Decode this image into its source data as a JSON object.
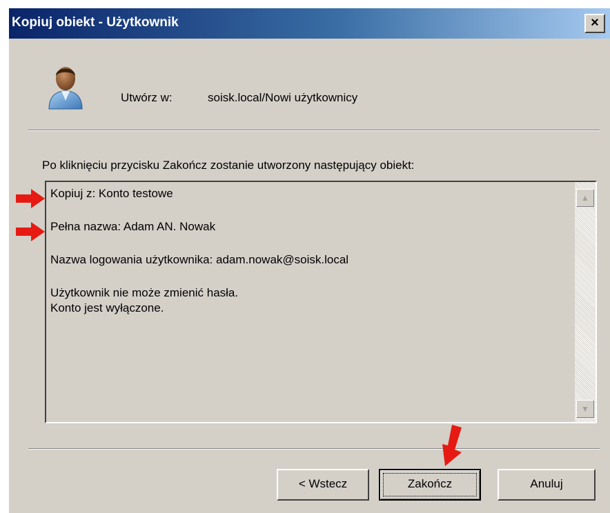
{
  "window": {
    "title": "Kopiuj obiekt - Użytkownik",
    "close_glyph": "×"
  },
  "header": {
    "icon": "user-icon",
    "create_label": "Utwórz w:",
    "create_path": "soisk.local/Nowi użytkownicy"
  },
  "intro": "Po kliknięciu przycisku Zakończ zostanie utworzony następujący obiekt:",
  "summary": {
    "copy_from": "Kopiuj z: Konto testowe",
    "full_name": "Pełna nazwa: Adam AN. Nowak",
    "logon_name": "Nazwa logowania użytkownika: adam.nowak@soisk.local",
    "cannot_change_password": "Użytkownik nie może zmienić hasła.",
    "account_disabled": "Konto jest wyłączone."
  },
  "scrollbar": {
    "up_glyph": "▲",
    "down_glyph": "▼"
  },
  "buttons": {
    "back": "< Wstecz",
    "finish": "Zakończ",
    "cancel": "Anuluj"
  },
  "annotations": {
    "arrow_color": "#e61a12"
  }
}
